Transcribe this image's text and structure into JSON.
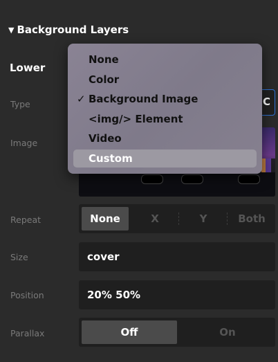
{
  "section": {
    "title": "Background Layers",
    "caret": "▼"
  },
  "layer": {
    "title": "Lower"
  },
  "labels": {
    "type": "Type",
    "image": "Image",
    "repeat": "Repeat",
    "size": "Size",
    "position": "Position",
    "parallax": "Parallax"
  },
  "type_select": {
    "visible_fragment": "C"
  },
  "type_menu": {
    "items": [
      {
        "label": "None"
      },
      {
        "label": "Color"
      },
      {
        "label": "Background Image",
        "check": "✓"
      },
      {
        "label": "<img/> Element"
      },
      {
        "label": "Video"
      },
      {
        "label": "Custom"
      }
    ],
    "selected": "Background Image",
    "hovered": "Custom"
  },
  "repeat": {
    "options": [
      "None",
      "X",
      "Y",
      "Both"
    ],
    "selected": "None"
  },
  "size": {
    "value": "cover"
  },
  "position": {
    "value": "20% 50%"
  },
  "parallax": {
    "options": [
      "Off",
      "On"
    ],
    "selected": "Off"
  },
  "colors": {
    "panel_bg": "#2b2b2b",
    "field_bg": "#1f1f1f",
    "accent_border": "#2f73d8",
    "menu_bg": "#8a8394",
    "menu_highlight": "#9c99a2"
  }
}
